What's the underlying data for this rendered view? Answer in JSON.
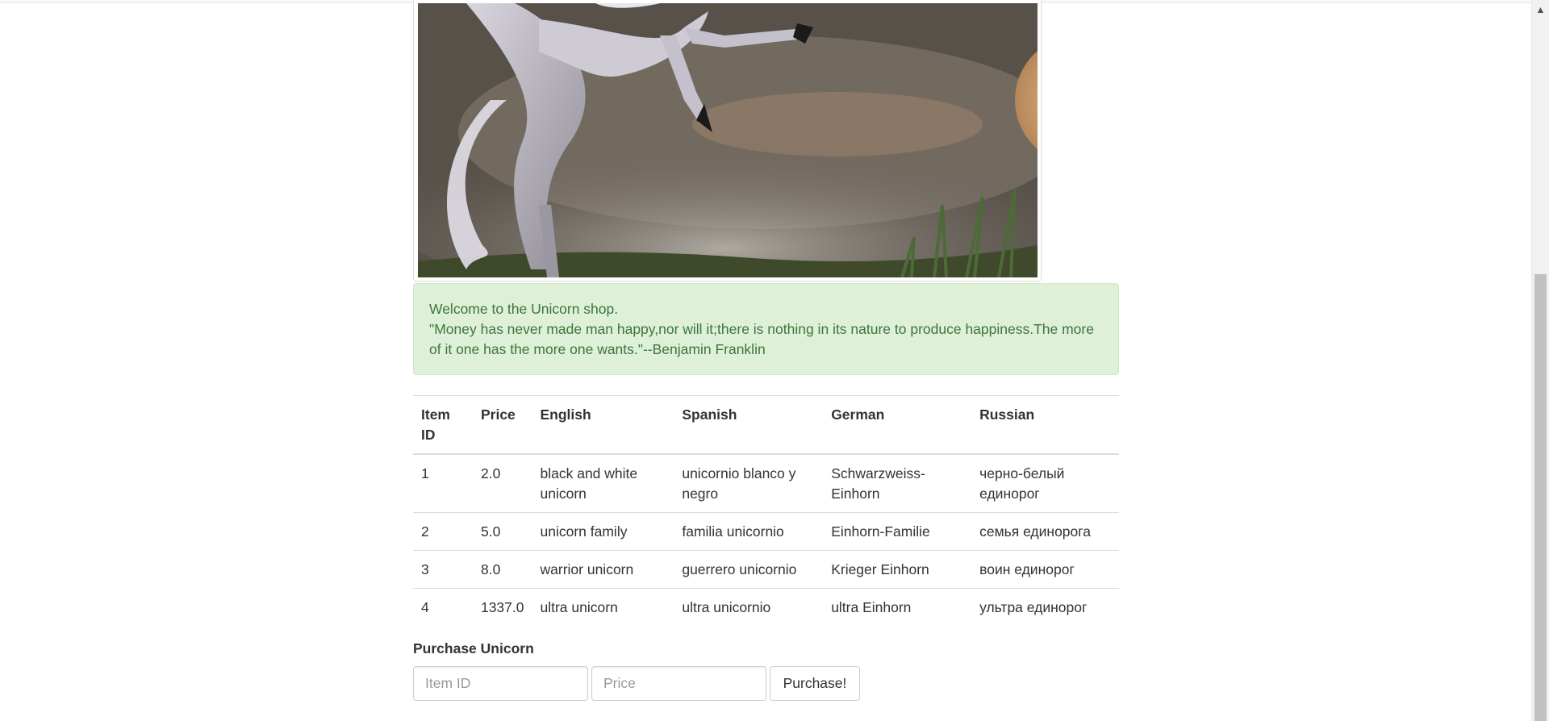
{
  "hero": {
    "image_name": "rearing-white-unicorn-image"
  },
  "alert": {
    "welcome": "Welcome to the Unicorn shop.",
    "quote": "\"Money has never made man happy,nor will it;there is nothing in its nature to produce happiness.The more of it one has the more one wants.\"--Benjamin Franklin"
  },
  "table": {
    "headers": {
      "item_id": "Item ID",
      "price": "Price",
      "english": "English",
      "spanish": "Spanish",
      "german": "German",
      "russian": "Russian"
    },
    "rows": [
      {
        "item_id": "1",
        "price": "2.0",
        "english": "black and white unicorn",
        "spanish": "unicornio blanco y negro",
        "german": "Schwarzweiss-Einhorn",
        "russian": "черно-белый единорог"
      },
      {
        "item_id": "2",
        "price": "5.0",
        "english": "unicorn family",
        "spanish": "familia unicornio",
        "german": "Einhorn-Familie",
        "russian": "семья единорога"
      },
      {
        "item_id": "3",
        "price": "8.0",
        "english": "warrior unicorn",
        "spanish": "guerrero unicornio",
        "german": "Krieger Einhorn",
        "russian": "воин единорог"
      },
      {
        "item_id": "4",
        "price": "1337.0",
        "english": "ultra unicorn",
        "spanish": "ultra unicornio",
        "german": "ultra Einhorn",
        "russian": "ультра единорог"
      }
    ]
  },
  "purchase": {
    "label": "Purchase Unicorn",
    "item_id_placeholder": "Item ID",
    "price_placeholder": "Price",
    "button_label": "Purchase!"
  },
  "colors": {
    "alert_bg": "#dff0d8",
    "alert_text": "#3c763d",
    "table_border": "#dddddd"
  }
}
